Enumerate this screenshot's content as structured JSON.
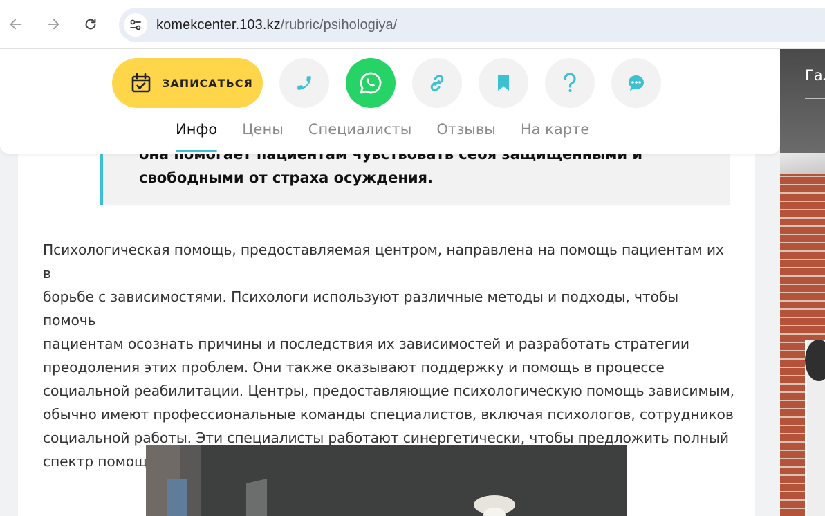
{
  "browser": {
    "url_host": "komekcenter.103.kz",
    "url_path": "/rubric/psihologiya/",
    "icons": [
      "back-arrow-icon",
      "forward-arrow-icon",
      "reload-icon",
      "site-settings-icon"
    ]
  },
  "actions": {
    "book_label": "ЗАПИСАТЬСЯ",
    "buttons": [
      "phone-icon",
      "whatsapp-icon",
      "link-icon",
      "bookmark-icon",
      "question-icon",
      "chat-icon"
    ]
  },
  "tabs": [
    {
      "label": "Инфо",
      "active": true
    },
    {
      "label": "Цены",
      "active": false
    },
    {
      "label": "Специалисты",
      "active": false
    },
    {
      "label": "Отзывы",
      "active": false
    },
    {
      "label": "На карте",
      "active": false
    }
  ],
  "article": {
    "quote_line1": "она помогает пациентам чувствовать себя защищенными и",
    "quote_line2": "свободными от страха осуждения.",
    "paragraph_lines": [
      "Психологическая помощь, предоставляемая центром, направлена на помощь пациентам их в",
      "борьбе с зависимостями. Психологи используют различные методы и подходы, чтобы помочь",
      "пациентам осознать причины и последствия их зависимостей и разработать стратегии",
      "преодоления этих проблем. Они также оказывают поддержку и помощь в процессе",
      "социальной реабилитации. Центры, предоставляющие психологическую помощь зависимым,",
      "обычно имеют профессиональные команды специалистов, включая психологов, сотрудников",
      "социальной работы. Эти специалисты работают синергетически, чтобы предложить полный",
      "спектр помощи, включая психологическую и социальную поддержку."
    ]
  },
  "side_panel": {
    "label": "Гал"
  },
  "colors": {
    "accent": "#3cc1d1",
    "book_button": "#ffd54a",
    "whatsapp": "#25d366"
  }
}
